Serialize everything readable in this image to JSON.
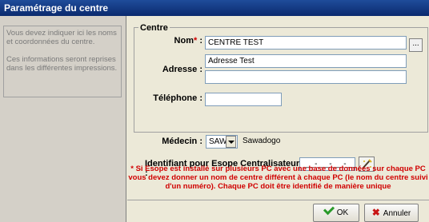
{
  "window": {
    "title": "Paramétrage du centre"
  },
  "info": {
    "para1": "Vous devez indiquer ici les noms et coordonnées du centre.",
    "para2": "Ces informations seront reprises dans les différentes impressions."
  },
  "centre": {
    "group_label": "Centre",
    "nom_label": "Nom",
    "nom_required": "*",
    "nom_colon": " :",
    "nom_value": "CENTRE TEST",
    "browse_label": "...",
    "adresse_label": "Adresse :",
    "adresse_line1": "Adresse Test",
    "adresse_line2": "",
    "telephone_label": "Téléphone :",
    "telephone_value": ""
  },
  "medecin": {
    "label": "Médecin :",
    "code": "SAW",
    "name": "Sawadogo"
  },
  "identifiant": {
    "label": "Identifiant pour Esope Centralisateur",
    "required": "*",
    "colon": " :",
    "value": "___-___-___-__"
  },
  "warning": "* Si Esope est installé sur plusieurs PC avec une base de données sur chaque PC vous devez donner un nom de centre différent à chaque PC (le nom du centre suivi d'un numéro). Chaque PC doit être identifié de manière unique",
  "buttons": {
    "ok": "OK",
    "cancel": "Annuler"
  },
  "colors": {
    "title_bar": "#0a2a6e",
    "required": "#d00000",
    "ok_check": "#2a9a2a",
    "cancel_x": "#c81414"
  },
  "icons": {
    "ok": "checkmark-icon",
    "cancel": "cross-icon",
    "generate": "magic-wand-icon"
  }
}
